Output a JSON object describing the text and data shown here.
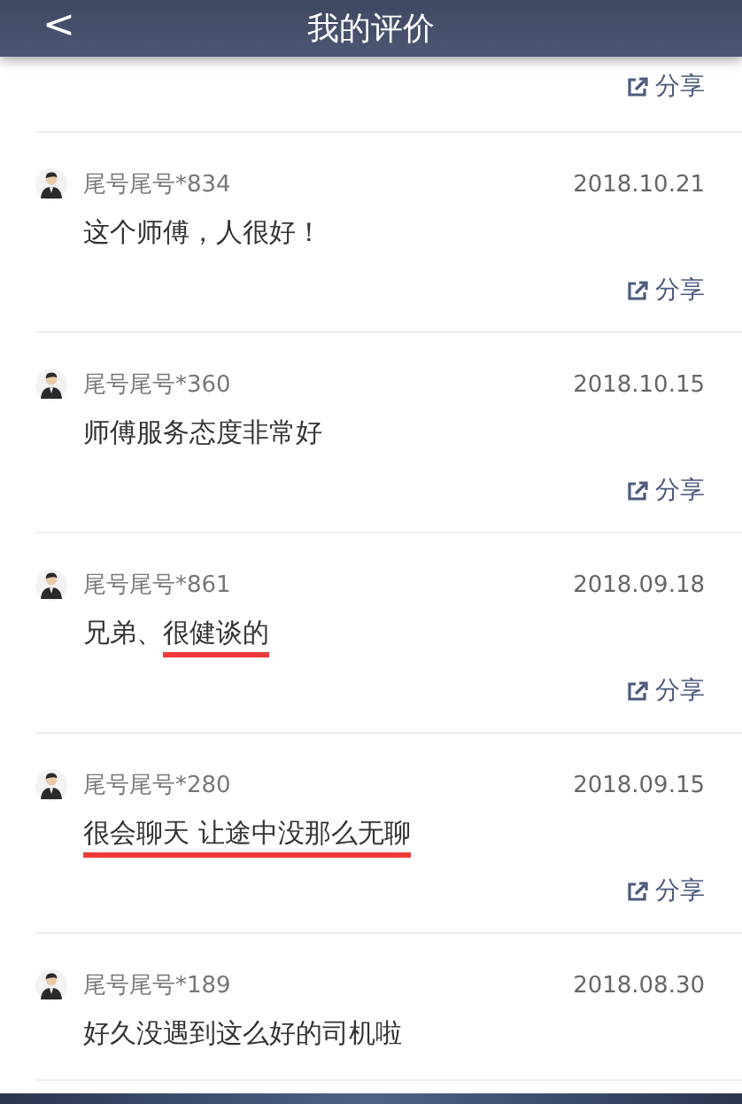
{
  "header": {
    "back_icon": "<",
    "title": "我的评价"
  },
  "top_share": {
    "label": "分享"
  },
  "reviews": [
    {
      "user": "尾号尾号*834",
      "date": "2018.10.21",
      "comment": [
        {
          "text": "这个师傅，人很好！",
          "underlined": false
        }
      ],
      "share": "分享"
    },
    {
      "user": "尾号尾号*360",
      "date": "2018.10.15",
      "comment": [
        {
          "text": "师傅服务态度非常好",
          "underlined": false
        }
      ],
      "share": "分享"
    },
    {
      "user": "尾号尾号*861",
      "date": "2018.09.18",
      "comment": [
        {
          "text": "兄弟、",
          "underlined": false
        },
        {
          "text": "很健谈的",
          "underlined": true
        }
      ],
      "share": "分享"
    },
    {
      "user": "尾号尾号*280",
      "date": "2018.09.15",
      "comment": [
        {
          "text": "很会聊天 让途中没那么无聊",
          "underlined": true
        }
      ],
      "share": "分享"
    },
    {
      "user": "尾号尾号*189",
      "date": "2018.08.30",
      "comment": [
        {
          "text": "好久没遇到这么好的司机啦",
          "underlined": false
        }
      ]
    }
  ]
}
